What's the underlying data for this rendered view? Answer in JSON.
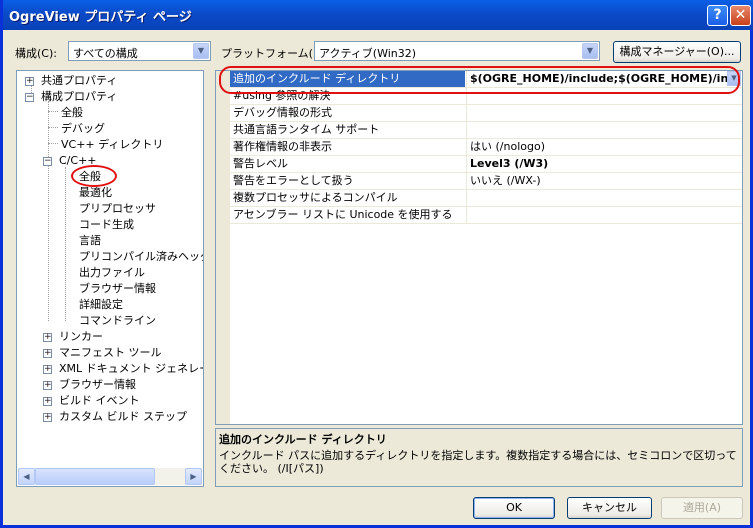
{
  "window": {
    "title": "OgreView プロパティ ページ",
    "help": "?",
    "close": "✕"
  },
  "toolbar": {
    "config_label": "構成(C):",
    "config_value": "すべての構成",
    "platform_label": "プラットフォーム(P):",
    "platform_value": "アクティブ(Win32)",
    "config_manager": "構成マネージャー(O)..."
  },
  "tree": {
    "common": "共通プロパティ",
    "config_props": "構成プロパティ",
    "general": "全般",
    "debug": "デバッグ",
    "vc_dirs": "VC++ ディレクトリ",
    "cpp": "C/C++",
    "cpp_general": "全般",
    "optimization": "最適化",
    "preprocessor": "プリプロセッサ",
    "code_gen": "コード生成",
    "language": "言語",
    "pch": "プリコンパイル済みヘッダー",
    "output_files": "出力ファイル",
    "browse_info": "ブラウザー情報",
    "advanced": "詳細設定",
    "cmdline": "コマンドライン",
    "linker": "リンカー",
    "manifest": "マニフェスト ツール",
    "xml_doc": "XML ドキュメント ジェネレーター",
    "browse_info2": "ブラウザー情報",
    "build_events": "ビルド イベント",
    "custom_build": "カスタム ビルド ステップ"
  },
  "grid": {
    "rows": [
      {
        "name": "追加のインクルード ディレクトリ",
        "value": "$(OGRE_HOME)/include;$(OGRE_HOME)/include",
        "bold": true
      },
      {
        "name": "#using 参照の解決",
        "value": "",
        "bold": false
      },
      {
        "name": "デバッグ情報の形式",
        "value": "",
        "bold": false
      },
      {
        "name": "共通言語ランタイム サポート",
        "value": "",
        "bold": false
      },
      {
        "name": "著作権情報の非表示",
        "value": "はい (/nologo)",
        "bold": false
      },
      {
        "name": "警告レベル",
        "value": "Level3 (/W3)",
        "bold": true
      },
      {
        "name": "警告をエラーとして扱う",
        "value": "いいえ (/WX-)",
        "bold": false
      },
      {
        "name": "複数プロセッサによるコンパイル",
        "value": "",
        "bold": false
      },
      {
        "name": "アセンブラー リストに Unicode を使用する",
        "value": "",
        "bold": false
      }
    ]
  },
  "description": {
    "title": "追加のインクルード ディレクトリ",
    "text": "インクルード パスに追加するディレクトリを指定します。複数指定する場合には、セミコロンで区切ってください。 (/I[パス])"
  },
  "buttons": {
    "ok": "OK",
    "cancel": "キャンセル",
    "apply": "適用(A)"
  },
  "colors": {
    "accent": "#316ac5",
    "annotation": "#e01010"
  }
}
